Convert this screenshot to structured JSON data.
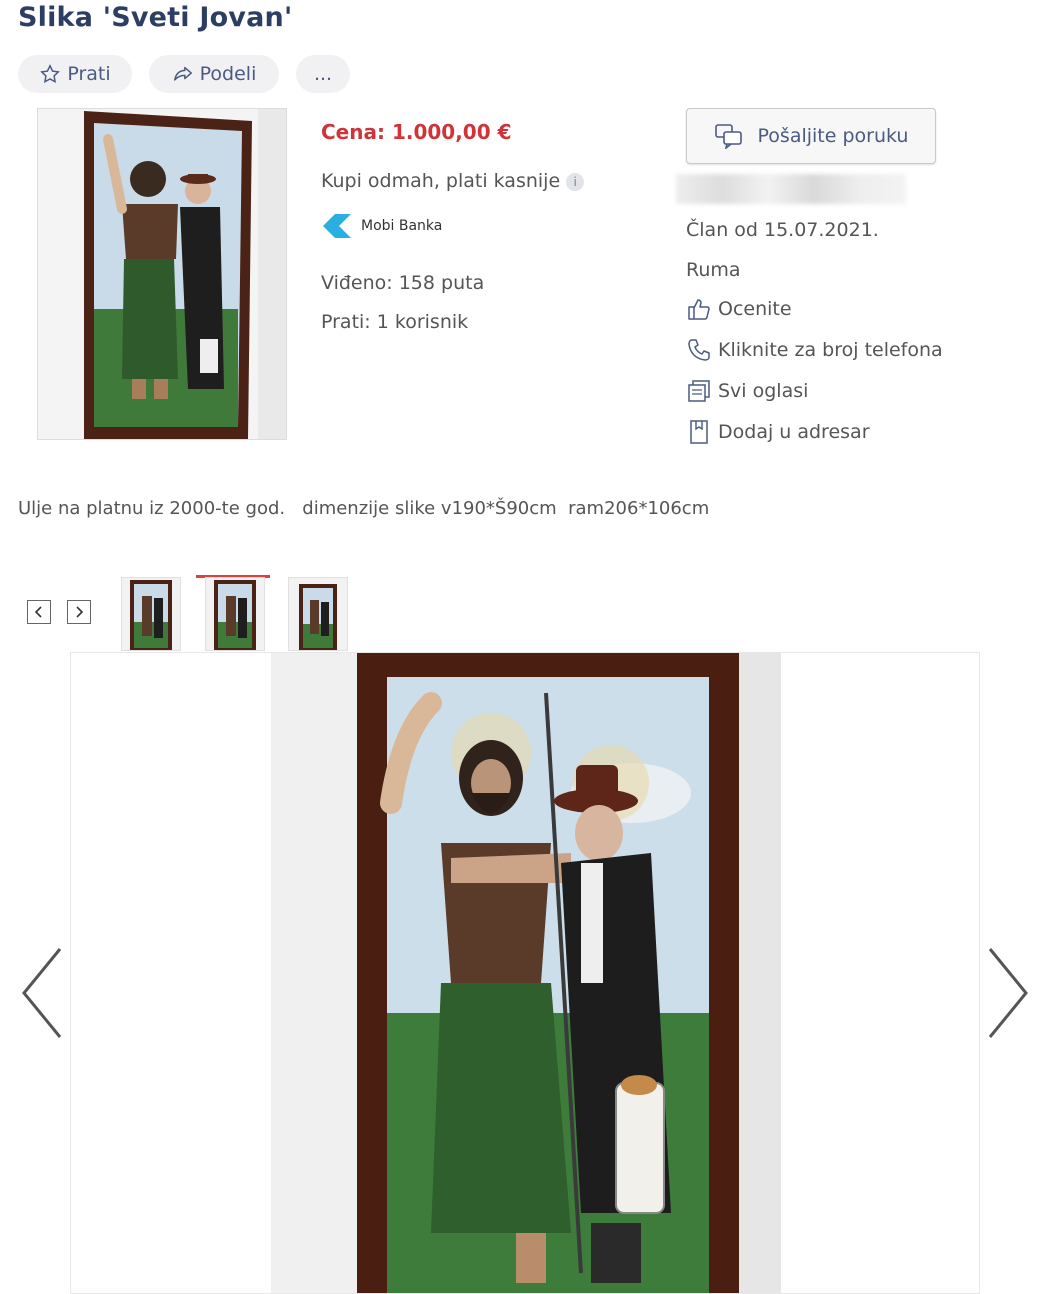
{
  "listing": {
    "title": "Slika 'Sveti Jovan'",
    "actions": {
      "follow_label": "Prati",
      "share_label": "Podeli",
      "more_label": "..."
    },
    "price": "Cena: 1.000,00 €",
    "buy_now": "Kupi odmah, plati kasnije",
    "info_badge": "i",
    "mobi_banka": "Mobi Banka",
    "views": "Viđeno: 158 puta",
    "followers": "Prati: 1 korisnik",
    "description": "Ulje na platnu iz 2000-te god.   dimenzije slike v190*Š90cm  ram206*106cm"
  },
  "seller": {
    "send_message_label": "Pošaljite poruku",
    "member_since": "Član od 15.07.2021.",
    "location": "Ruma",
    "rate_label": "Ocenite",
    "phone_label": "Kliknite za broj telefona",
    "all_ads_label": "Svi oglasi",
    "add_contact_label": "Dodaj u adresar"
  },
  "gallery": {
    "thumbnail_count": 3,
    "active_thumbnail": 2
  },
  "colors": {
    "accent_red": "#d0343a",
    "link_blue": "#4a5a82",
    "title_navy": "#2d3e63",
    "frame_brown": "#5a2a1a"
  }
}
